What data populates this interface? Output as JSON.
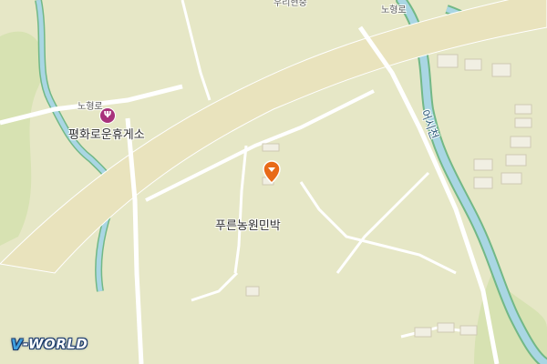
{
  "map": {
    "logo": {
      "prefix": "V",
      "suffix": "-WORLD"
    },
    "labels": {
      "poi_restaurant": "평화로운휴게소",
      "poi_accommodation": "푸른농원민박",
      "road_left": "노형로",
      "road_top": "노형로",
      "river": "어시천",
      "top_cut": "우리현중"
    },
    "icons": {
      "restaurant": "fork-knife-icon",
      "selected_location": "location-pin-icon"
    },
    "colors": {
      "land": "#e6e7c6",
      "highway": "#e9e3bd",
      "road": "#ffffff",
      "river": "#a9d6e3",
      "river_edge": "#72b886",
      "poi_restaurant": "#a8327c",
      "pin": "#e86a18"
    }
  }
}
